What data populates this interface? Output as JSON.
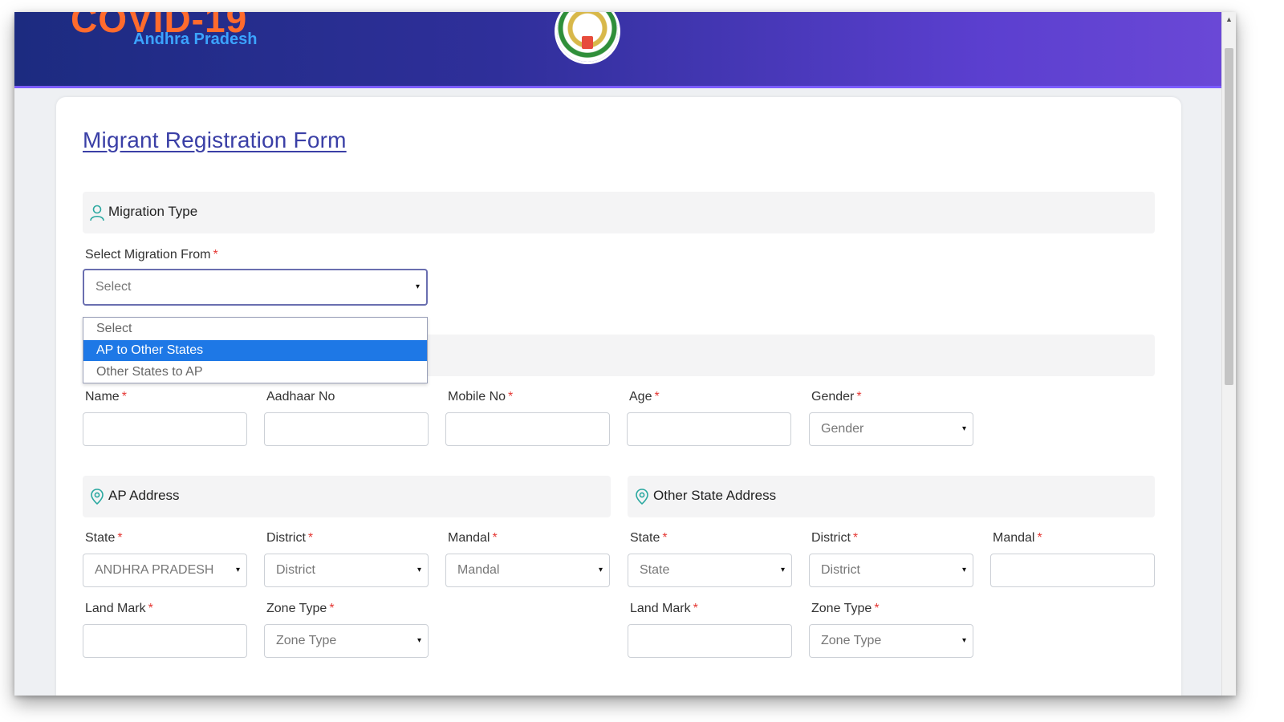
{
  "header": {
    "brand_title": "COVID-19",
    "brand_subtitle": "Andhra Pradesh",
    "emblem_icon": "state-emblem-icon"
  },
  "form": {
    "title": "Migrant Registration Form",
    "sections": {
      "migration_type": "Migration Type",
      "ap_address": "AP Address",
      "other_state_address": "Other State Address"
    },
    "migration_from": {
      "label": "Select Migration From",
      "value": "Select",
      "options": [
        "Select",
        "AP to Other States",
        "Other States to AP"
      ],
      "highlighted": "AP to Other States"
    },
    "personal": {
      "name_label": "Name",
      "aadhaar_label": "Aadhaar No",
      "mobile_label": "Mobile No",
      "age_label": "Age",
      "gender_label": "Gender",
      "gender_value": "Gender"
    },
    "ap_address": {
      "state_label": "State",
      "state_value": "ANDHRA PRADESH",
      "district_label": "District",
      "district_value": "District",
      "mandal_label": "Mandal",
      "mandal_value": "Mandal",
      "landmark_label": "Land Mark",
      "zone_label": "Zone Type",
      "zone_value": "Zone Type"
    },
    "other_address": {
      "state_label": "State",
      "state_value": "State",
      "district_label": "District",
      "district_value": "District",
      "mandal_label": "Mandal",
      "landmark_label": "Land Mark",
      "zone_label": "Zone Type",
      "zone_value": "Zone Type"
    },
    "required_mark": "*",
    "caret": "▾"
  },
  "colors": {
    "header_start": "#1c2b80",
    "header_end": "#6a48d6",
    "brand_orange": "#ff6b2d",
    "brand_blue": "#3ba3ff",
    "title_link": "#3a3fa6",
    "highlight": "#1e78e6",
    "required": "#e53935"
  }
}
